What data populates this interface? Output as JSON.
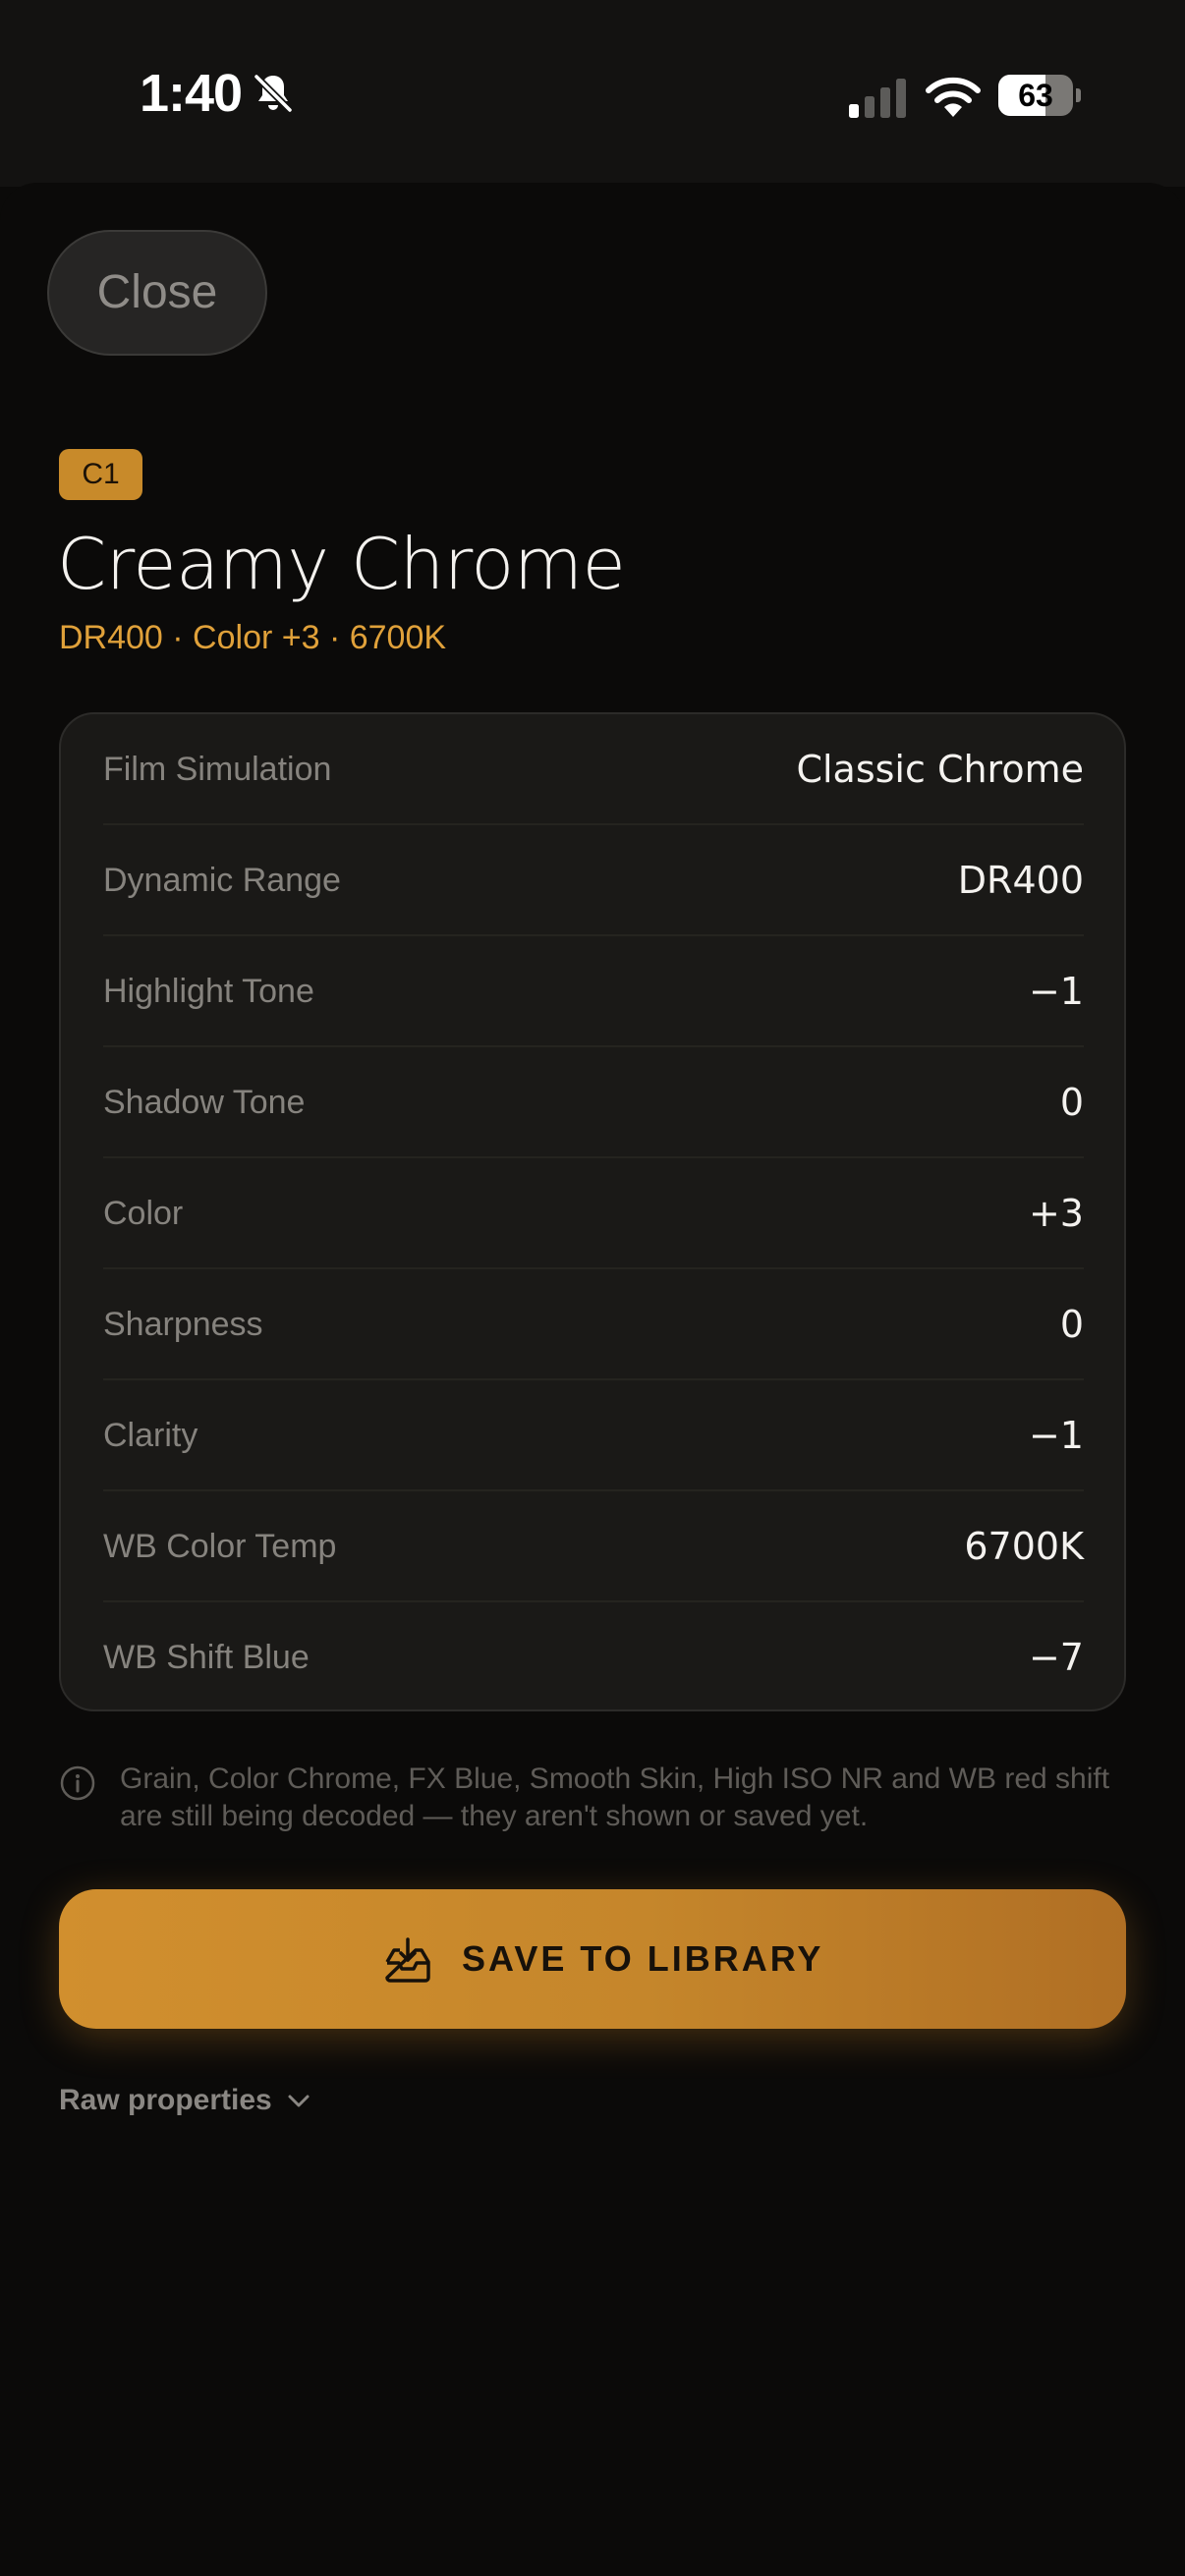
{
  "status_bar": {
    "time": "1:40",
    "battery_level": "63",
    "battery_fraction": 0.63,
    "icons": [
      "bell-slash-icon",
      "cellular-signal-icon",
      "wifi-icon",
      "battery-icon"
    ]
  },
  "header": {
    "close_label": "Close",
    "badge": "C1",
    "title": "Creamy Chrome",
    "subtitle": "DR400 · Color +3 · 6700K"
  },
  "settings": [
    {
      "label": "Film Simulation",
      "value": "Classic Chrome"
    },
    {
      "label": "Dynamic Range",
      "value": "DR400"
    },
    {
      "label": "Highlight Tone",
      "value": "−1"
    },
    {
      "label": "Shadow Tone",
      "value": "0"
    },
    {
      "label": "Color",
      "value": "+3"
    },
    {
      "label": "Sharpness",
      "value": "0"
    },
    {
      "label": "Clarity",
      "value": "−1"
    },
    {
      "label": "WB Color Temp",
      "value": "6700K"
    },
    {
      "label": "WB Shift Blue",
      "value": "−7"
    }
  ],
  "notice": {
    "icon": "info-icon",
    "text": "Grain, Color Chrome, FX Blue, Smooth Skin, High ISO NR and WB red shift are still being decoded — they aren't shown or saved yet."
  },
  "save_button": {
    "icon": "tray-download-icon",
    "label": "SAVE TO LIBRARY"
  },
  "raw_properties": {
    "label": "Raw properties",
    "icon": "chevron-down-icon"
  },
  "colors": {
    "accent": "#d1902e",
    "background": "#0b0a09",
    "card": "#1a1917"
  }
}
